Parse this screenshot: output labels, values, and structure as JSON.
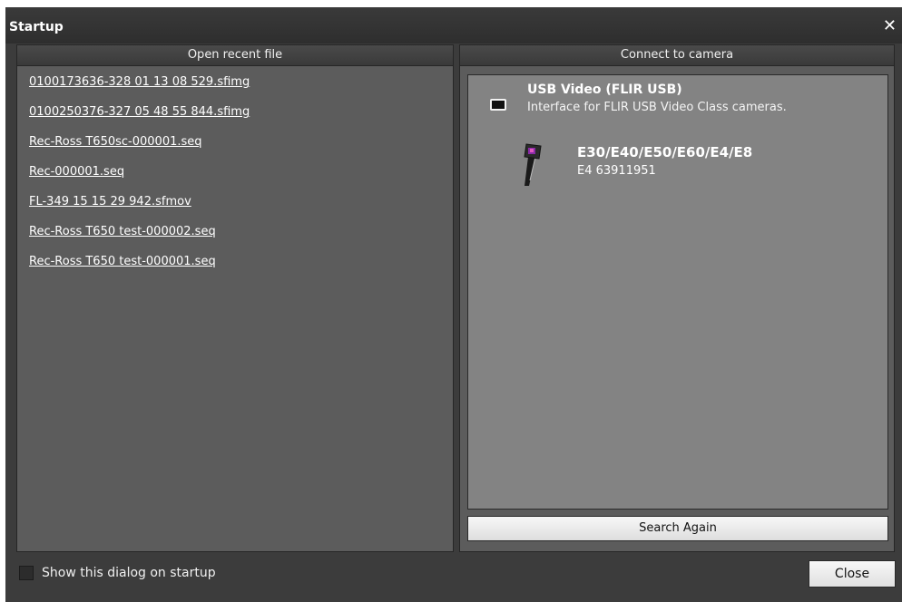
{
  "window": {
    "title": "Startup",
    "close_glyph": "✕"
  },
  "recent_files": {
    "header": "Open recent file",
    "items": [
      "0100173636-328 01 13 08 529.sfimg",
      "0100250376-327 05 48 55 844.sfimg",
      "Rec-Ross T650sc-000001.seq",
      "Rec-000001.seq",
      "FL-349 15 15 29 942.sfmov",
      "Rec-Ross T650 test-000002.seq",
      "Rec-Ross T650 test-000001.seq"
    ]
  },
  "camera": {
    "header": "Connect to camera",
    "interface": {
      "icon": "usb-device-icon",
      "title": "USB Video (FLIR USB)",
      "description": "Interface for FLIR USB Video Class cameras."
    },
    "devices": [
      {
        "icon": "thermal-camera-icon",
        "model": "E30/E40/E50/E60/E4/E8",
        "serial": "E4 63911951"
      }
    ],
    "search_button": "Search Again"
  },
  "footer": {
    "show_on_startup_label": "Show this dialog on startup",
    "show_on_startup_checked": false,
    "close_button": "Close"
  },
  "colors": {
    "dialog_bg": "#3c3c3c",
    "panel_bg": "#5c5c5c",
    "camera_box_bg": "#838383",
    "text": "#ffffff"
  }
}
